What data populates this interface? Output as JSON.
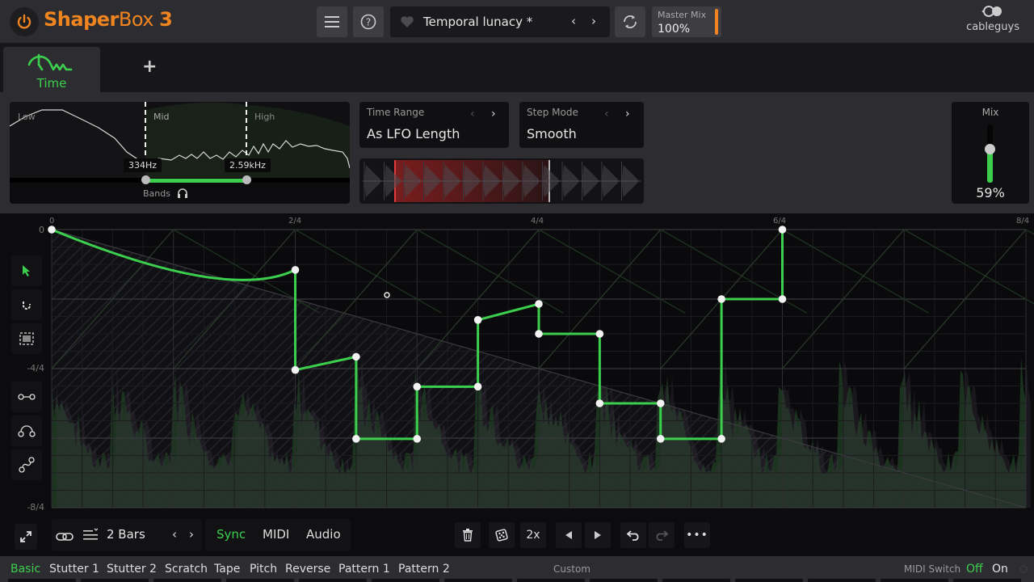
{
  "app": {
    "title_bold": "Shaper",
    "title_regular": "Box ",
    "title_number": "3",
    "brand": "cableguys",
    "accent_orange": "#f0851f",
    "accent_green": "#3ccf4e"
  },
  "toolbar": {
    "menu_icon": "hamburger-icon",
    "help_icon": "question-circle-icon",
    "preset_favorite_icon": "heart-icon",
    "preset_name": "Temporal lunacy *",
    "prev_arrow": "‹",
    "next_arrow": "›",
    "refresh_icon": "refresh-icon",
    "master_mix_label": "Master Mix",
    "master_mix_value": "100%"
  },
  "tabs": {
    "items": [
      {
        "label": "Time",
        "icon": "time-shaper-icon",
        "active": true
      }
    ],
    "add_label": "+"
  },
  "bands": {
    "low_label": "Low",
    "mid_label": "Mid",
    "high_label": "High",
    "low_split": "334Hz",
    "high_split": "2.59kHz",
    "bands_label": "Bands",
    "headphone_icon": "headphones-icon"
  },
  "time_range": {
    "label": "Time Range",
    "value": "As LFO Length",
    "prev": "‹",
    "next": "›"
  },
  "step_mode": {
    "label": "Step Mode",
    "value": "Smooth",
    "prev": "‹",
    "next": "›"
  },
  "mix": {
    "label": "Mix",
    "value": "59%",
    "fraction": 0.59
  },
  "editor": {
    "x_labels": [
      "0",
      "2/4",
      "4/4",
      "6/4",
      "8/4"
    ],
    "y_labels": [
      "0",
      "-4/4",
      "-8/4"
    ],
    "tools": [
      {
        "name": "pointer-tool",
        "icon": "cursor-arrow-icon",
        "active": true
      },
      {
        "name": "magnet-tool",
        "icon": "magnet-icon",
        "active": false
      },
      {
        "name": "select-tool",
        "icon": "marquee-select-icon",
        "active": false
      },
      {
        "name": "line-tool",
        "icon": "line-segment-icon",
        "active": false
      },
      {
        "name": "curve-tool",
        "icon": "arc-curve-icon",
        "active": false
      },
      {
        "name": "s-curve-tool",
        "icon": "s-curve-icon",
        "active": false
      }
    ],
    "points": [
      [
        0,
        0
      ],
      [
        4,
        -0.58
      ],
      [
        4,
        -2.02
      ],
      [
        5,
        -1.83
      ],
      [
        5,
        -3.01
      ],
      [
        6,
        -3.01
      ],
      [
        6,
        -2.26
      ],
      [
        7,
        -2.26
      ],
      [
        7,
        -1.3
      ],
      [
        8,
        -1.07
      ],
      [
        8,
        -1.5
      ],
      [
        9,
        -1.5
      ],
      [
        9,
        -2.5
      ],
      [
        10,
        -2.5
      ],
      [
        10,
        -3.01
      ],
      [
        11,
        -3.01
      ],
      [
        11,
        -1.0
      ],
      [
        12,
        -1.0
      ],
      [
        12,
        0
      ]
    ]
  },
  "bottom": {
    "expand_icon": "expand-icon",
    "link_icon": "link-icon",
    "length_icon": "list-length-icon",
    "length_value": "2 Bars",
    "prev": "‹",
    "next": "›",
    "modes": [
      {
        "label": "Sync",
        "active": true
      },
      {
        "label": "MIDI",
        "active": false
      },
      {
        "label": "Audio",
        "active": false
      }
    ],
    "delete_icon": "trash-icon",
    "random_icon": "dice-icon",
    "double_label": "2x",
    "shift_left_icon": "triangle-left-icon",
    "shift_right_icon": "triangle-right-icon",
    "undo_icon": "undo-icon",
    "redo_icon": "redo-icon",
    "more_label": "•••"
  },
  "presets": {
    "items": [
      {
        "label": "Basic",
        "active": true
      },
      {
        "label": "Stutter 1",
        "active": false
      },
      {
        "label": "Stutter 2",
        "active": false
      },
      {
        "label": "Scratch",
        "active": false
      },
      {
        "label": "Tape",
        "active": false
      },
      {
        "label": "Pitch",
        "active": false
      },
      {
        "label": "Reverse",
        "active": false
      },
      {
        "label": "Pattern 1",
        "active": false
      },
      {
        "label": "Pattern 2",
        "active": false
      }
    ],
    "custom_label": "Custom",
    "midi_switch_label": "MIDI Switch",
    "midi_off": "Off",
    "midi_on": "On",
    "settings_icon": "gear-icon"
  }
}
